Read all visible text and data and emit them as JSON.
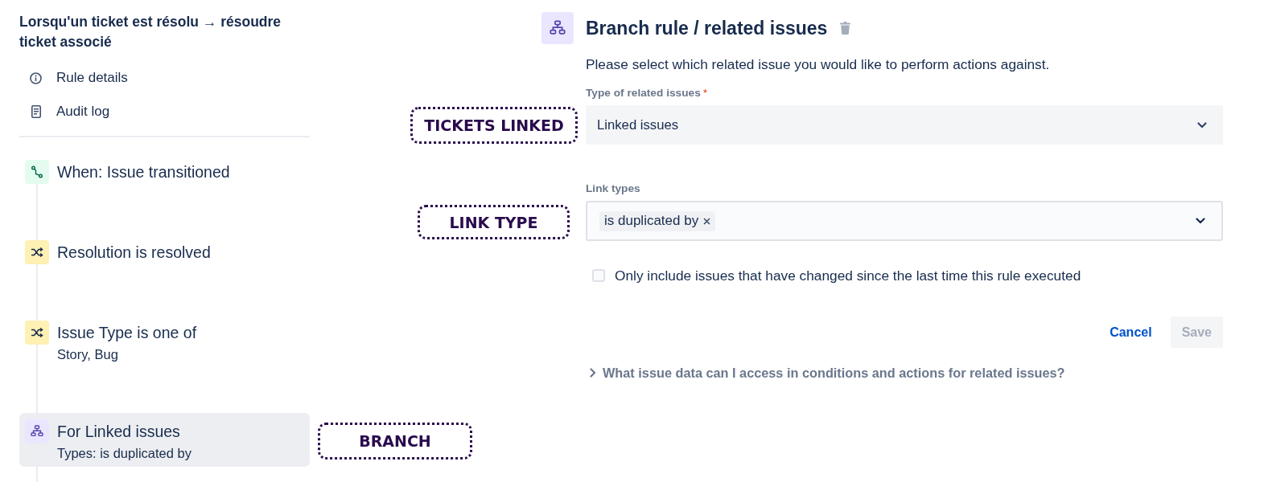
{
  "sidebar": {
    "rule_title": "Lorsqu'un ticket est résolu → résoudre ticket associé",
    "links": [
      {
        "kind": "details",
        "label": "Rule details"
      },
      {
        "kind": "audit",
        "label": "Audit log"
      }
    ],
    "steps": [
      {
        "kind": "trigger",
        "title": "When: Issue transitioned",
        "selected": false
      },
      {
        "kind": "condition",
        "title": "Resolution is resolved",
        "selected": false
      },
      {
        "kind": "condition",
        "title": "Issue Type is one of",
        "detail": "Story, Bug",
        "selected": false
      },
      {
        "kind": "branch",
        "title": "For Linked issues",
        "detail": "Types: is duplicated by",
        "selected": true
      }
    ]
  },
  "annotations": [
    {
      "label": "TICKETS LINKED"
    },
    {
      "label": "LINK TYPE"
    },
    {
      "label": "BRANCH"
    }
  ],
  "panel": {
    "kind": "branch",
    "title": "Branch rule / related issues",
    "description": "Please select which related issue you would like to perform actions against.",
    "fields": [
      {
        "kind": "select",
        "label": "Type of related issues",
        "required_mark": "*",
        "value": "Linked issues"
      },
      {
        "kind": "multiselect",
        "label": "Link types",
        "tags": [
          "is duplicated by"
        ]
      }
    ],
    "options": [
      {
        "label": "Only include issues that have changed since the last time this rule executed",
        "checked": false
      }
    ],
    "actions": [
      {
        "kind": "subtle",
        "label": "Cancel",
        "disabled": false
      },
      {
        "kind": "primary",
        "label": "Save",
        "disabled": true
      }
    ],
    "disclosure": {
      "label": "What issue data can I access in conditions and actions for related issues?",
      "expanded": false
    }
  }
}
